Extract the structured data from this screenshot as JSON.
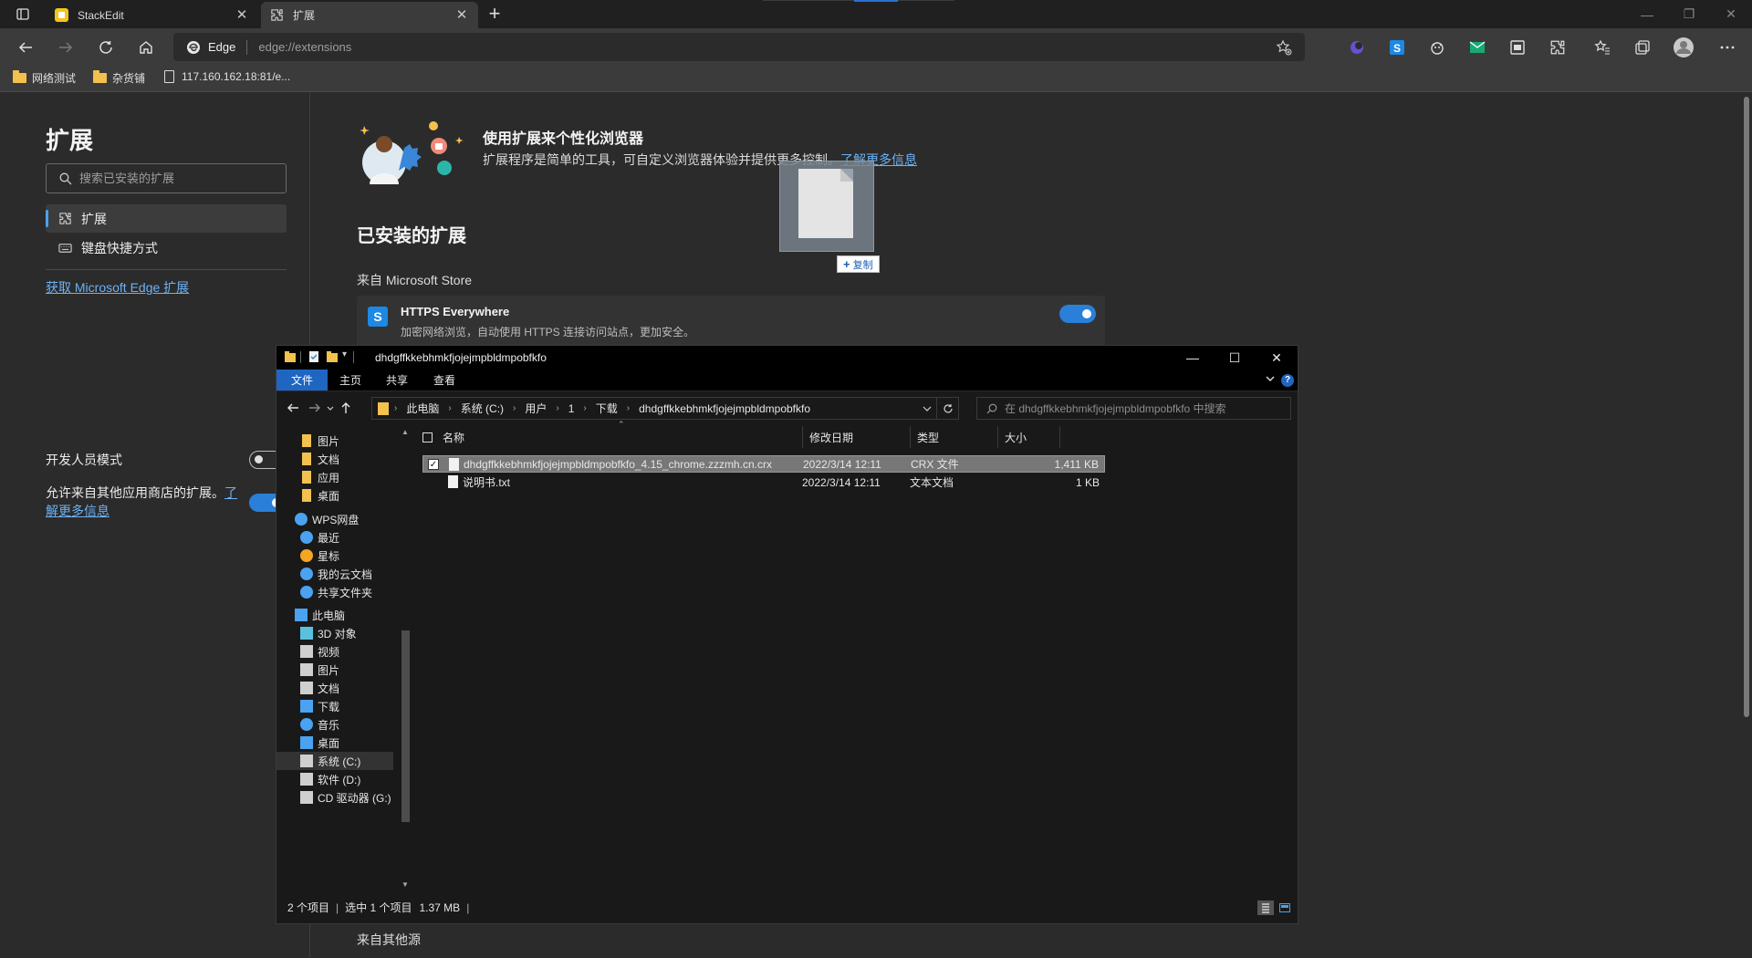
{
  "browser": {
    "tabs": [
      {
        "title": "StackEdit",
        "active": false
      },
      {
        "title": "扩展",
        "active": true
      }
    ],
    "address": {
      "scheme_label": "Edge",
      "url": "edge://extensions"
    },
    "bookmarks": [
      {
        "label": "网络测试",
        "type": "folder"
      },
      {
        "label": "杂货铺",
        "type": "folder"
      },
      {
        "label": "117.160.162.18:81/e...",
        "type": "page"
      }
    ],
    "toolbar_icons": [
      "collections-icon",
      "stackedit-icon",
      "mascot-icon",
      "mail-icon",
      "screenshot-icon",
      "extensions-icon",
      "favorites-icon",
      "tab-collections-icon",
      "profile-icon",
      "menu-icon"
    ]
  },
  "extensions_page": {
    "sidebar": {
      "title": "扩展",
      "search_placeholder": "搜索已安装的扩展",
      "nav": [
        {
          "label": "扩展",
          "active": true
        },
        {
          "label": "键盘快捷方式",
          "active": false
        }
      ],
      "get_link": "获取 Microsoft Edge 扩展",
      "dev_mode_label": "开发人员模式",
      "dev_mode_on": false,
      "allow_text": "允许来自其他应用商店的扩展。",
      "allow_link": "了解更多信息",
      "allow_on": true
    },
    "hero": {
      "title": "使用扩展来个性化浏览器",
      "desc": "扩展程序是简单的工具，可自定义浏览器体验并提供更多控制。",
      "link": "了解更多信息"
    },
    "installed_title": "已安装的扩展",
    "from_store": "来自 Microsoft Store",
    "extensions": [
      {
        "name": "HTTPS Everywhere",
        "desc": "加密网络浏览，自动使用 HTTPS 连接访问站点，更加安全。",
        "enabled": true
      }
    ],
    "from_other": "来自其他源"
  },
  "drag": {
    "label": "复制"
  },
  "explorer": {
    "title": "dhdgffkkebhmkfjojejmpbldmpobfkfo",
    "ribbon_tabs": [
      {
        "label": "文件",
        "active": true
      },
      {
        "label": "主页",
        "active": false
      },
      {
        "label": "共享",
        "active": false
      },
      {
        "label": "查看",
        "active": false
      }
    ],
    "breadcrumb": [
      "此电脑",
      "系统 (C:)",
      "用户",
      "1",
      "下载",
      "dhdgffkkebhmkfjojejmpbldmpobfkfo"
    ],
    "search_placeholder": "在 dhdgffkkebhmkfjojejmpbldmpobfkfo 中搜索",
    "nav_items": [
      {
        "label": "图片",
        "icon": "folder-icon",
        "indent": 1,
        "selected": false
      },
      {
        "label": "文档",
        "icon": "folder-icon",
        "indent": 1,
        "selected": false
      },
      {
        "label": "应用",
        "icon": "folder-icon",
        "indent": 1,
        "selected": false
      },
      {
        "label": "桌面",
        "icon": "folder-icon",
        "indent": 1,
        "selected": false
      },
      {
        "label": "WPS网盘",
        "icon": "cloud-icon",
        "indent": 0,
        "selected": false
      },
      {
        "label": "最近",
        "icon": "clock-icon",
        "indent": 1,
        "selected": false
      },
      {
        "label": "星标",
        "icon": "star-icon",
        "indent": 1,
        "selected": false
      },
      {
        "label": "我的云文档",
        "icon": "cloud-icon",
        "indent": 1,
        "selected": false
      },
      {
        "label": "共享文件夹",
        "icon": "share-icon",
        "indent": 1,
        "selected": false
      },
      {
        "label": "此电脑",
        "icon": "computer-icon",
        "indent": 0,
        "selected": false
      },
      {
        "label": "3D 对象",
        "icon": "cube-icon",
        "indent": 1,
        "selected": false
      },
      {
        "label": "视频",
        "icon": "video-icon",
        "indent": 1,
        "selected": false
      },
      {
        "label": "图片",
        "icon": "picture-icon",
        "indent": 1,
        "selected": false
      },
      {
        "label": "文档",
        "icon": "document-icon",
        "indent": 1,
        "selected": false
      },
      {
        "label": "下载",
        "icon": "download-icon",
        "indent": 1,
        "selected": false
      },
      {
        "label": "音乐",
        "icon": "music-icon",
        "indent": 1,
        "selected": false
      },
      {
        "label": "桌面",
        "icon": "desktop-icon",
        "indent": 1,
        "selected": false
      },
      {
        "label": "系统 (C:)",
        "icon": "drive-icon",
        "indent": 1,
        "selected": true
      },
      {
        "label": "软件 (D:)",
        "icon": "drive-icon",
        "indent": 1,
        "selected": false
      },
      {
        "label": "CD 驱动器 (G:)",
        "icon": "cd-drive-icon",
        "indent": 1,
        "selected": false
      }
    ],
    "columns": [
      "名称",
      "修改日期",
      "类型",
      "大小"
    ],
    "files": [
      {
        "name": "dhdgffkkebhmkfjojejmpbldmpobfkfo_4.15_chrome.zzzmh.cn.crx",
        "date": "2022/3/14 12:11",
        "type": "CRX 文件",
        "size": "1,411 KB",
        "selected": true
      },
      {
        "name": "说明书.txt",
        "date": "2022/3/14 12:11",
        "type": "文本文档",
        "size": "1 KB",
        "selected": false
      }
    ],
    "status": {
      "count": "2 个项目",
      "selection": "选中 1 个项目",
      "size": "1.37 MB"
    }
  },
  "colors": {
    "accent": "#2a7fd9",
    "link": "#6cb2f5",
    "folder": "#f2c14e",
    "explorer_tab": "#1f66c2"
  }
}
